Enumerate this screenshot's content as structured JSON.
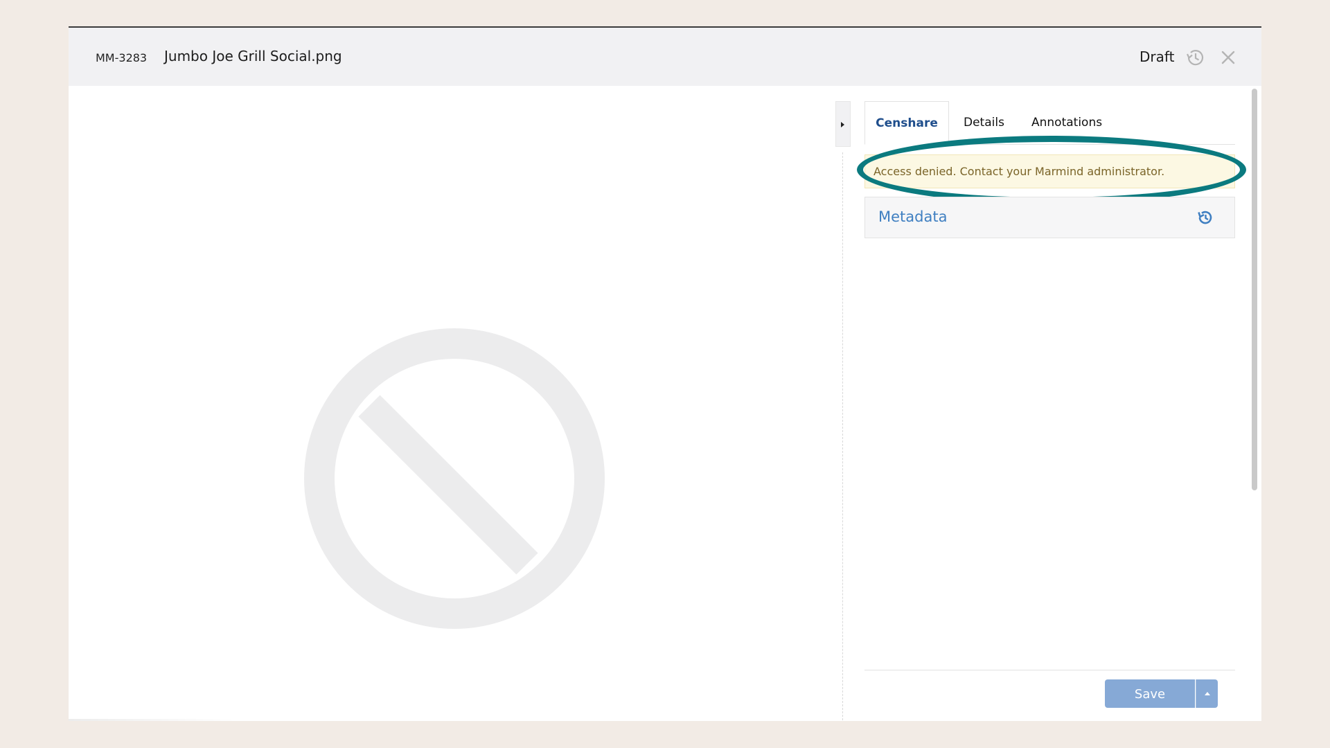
{
  "header": {
    "asset_id": "MM-3283",
    "title": "Jumbo Joe Grill Social.png",
    "status": "Draft",
    "history_icon": "history-icon",
    "close_icon": "close-icon"
  },
  "preview": {
    "icon": "no-entry-icon"
  },
  "sidebar": {
    "collapse_icon": "caret-right-icon",
    "tabs": [
      {
        "label": "Censhare",
        "active": true
      },
      {
        "label": "Details",
        "active": false
      },
      {
        "label": "Annotations",
        "active": false
      }
    ],
    "alert": {
      "text": "Access denied. Contact your Marmind administrator."
    },
    "metadata": {
      "label": "Metadata",
      "reset_icon": "reset-history-icon"
    },
    "footer": {
      "save_label": "Save",
      "save_menu_icon": "caret-up-icon"
    }
  },
  "colors": {
    "accent": "#3f7fc1",
    "active_tab": "#1f4e8c",
    "alert_bg": "#fcf8e3",
    "alert_text": "#7a6428",
    "highlight": "#0b7a7f",
    "save_button": "#86a9d6",
    "page_bg": "#f2ebe5"
  }
}
